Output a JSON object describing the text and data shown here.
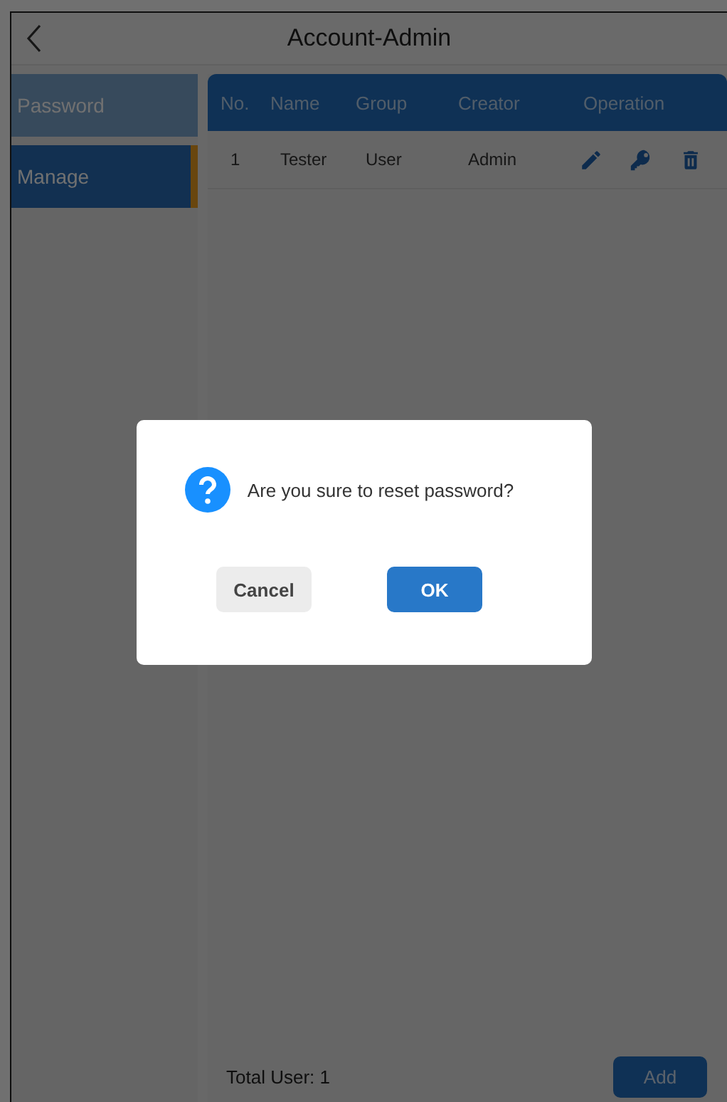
{
  "header": {
    "title": "Account-Admin"
  },
  "sidebar": {
    "items": [
      {
        "label": "Password",
        "selected": false
      },
      {
        "label": "Manage",
        "selected": true
      }
    ]
  },
  "table": {
    "columns": [
      "No.",
      "Name",
      "Group",
      "Creator",
      "Operation"
    ],
    "rows": [
      {
        "no": "1",
        "name": "Tester",
        "group": "User",
        "creator": "Admin"
      }
    ]
  },
  "footer": {
    "total_label": "Total User:",
    "total_value": "1",
    "add_button": "Add"
  },
  "dialog": {
    "message": "Are you sure to reset password?",
    "buttons": [
      {
        "label": "Cancel",
        "kind": "secondary"
      },
      {
        "label": "OK",
        "kind": "primary"
      }
    ]
  }
}
